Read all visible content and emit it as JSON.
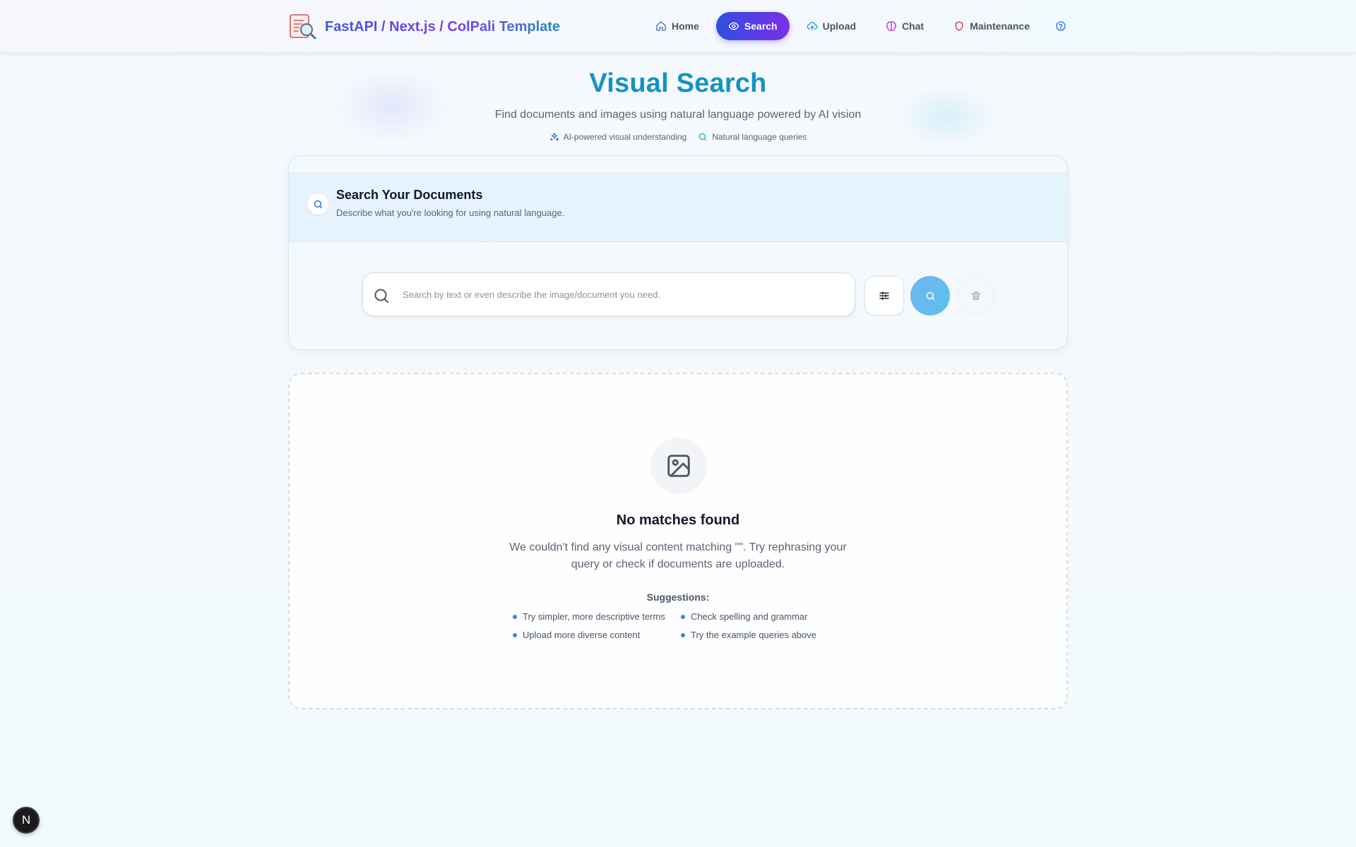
{
  "brand": {
    "title": "FastAPI / Next.js / ColPali Template"
  },
  "nav": {
    "items": [
      {
        "label": "Home",
        "icon": "home-icon"
      },
      {
        "label": "Search",
        "icon": "eye-icon",
        "active": true
      },
      {
        "label": "Upload",
        "icon": "cloud-upload-icon"
      },
      {
        "label": "Chat",
        "icon": "brain-icon"
      },
      {
        "label": "Maintenance",
        "icon": "shield-icon"
      }
    ],
    "help_icon": "help-circle-icon"
  },
  "hero": {
    "title": "Visual Search",
    "subtitle": "Find documents and images using natural language powered by AI vision",
    "tags": [
      {
        "label": "AI-powered visual understanding",
        "icon": "sparkles-icon"
      },
      {
        "label": "Natural language queries",
        "icon": "search-icon"
      }
    ]
  },
  "search_card": {
    "title": "Search Your Documents",
    "description": "Describe what you're looking for using natural language.",
    "input": {
      "value": "",
      "placeholder": "Search by text or even describe the image/document you need."
    },
    "buttons": {
      "filter": "sliders-icon",
      "search": "search-icon",
      "clear": "trash-icon"
    }
  },
  "empty_state": {
    "icon": "image-icon",
    "title": "No matches found",
    "description": "We couldn't find any visual content matching \"\". Try rephrasing your query or check if documents are uploaded.",
    "suggestions_title": "Suggestions:",
    "suggestions": [
      "Try simpler, more descriptive terms",
      "Check spelling and grammar",
      "Upload more diverse content",
      "Try the example queries above"
    ]
  },
  "dev_badge": {
    "label": "N"
  },
  "colors": {
    "accent_gradient_start": "#2f4fe0",
    "accent_gradient_end": "#7c2fe6",
    "hero_title": "#1393c4",
    "bullet": "#3b82f6"
  }
}
